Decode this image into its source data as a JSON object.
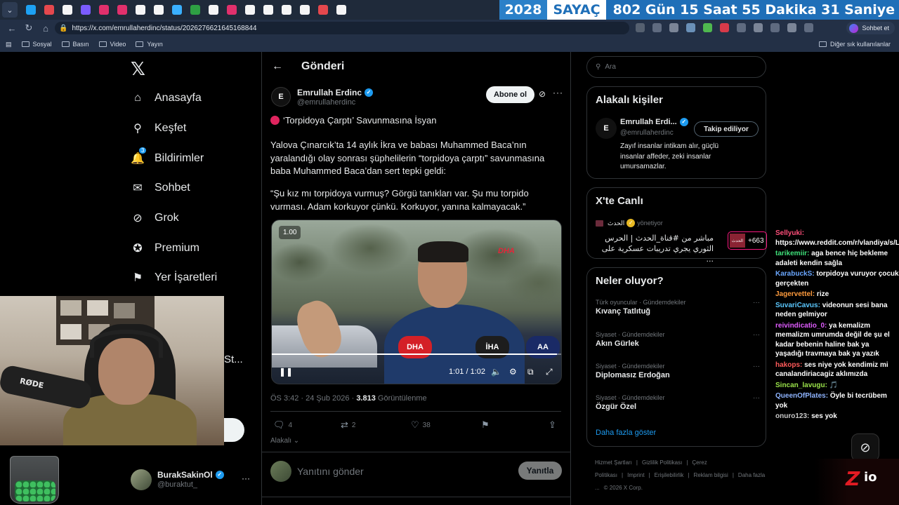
{
  "browser": {
    "url": "https://x.com/emrullaherdinc/status/2026276621645168844",
    "sohbet_label": "Sohbet et",
    "bookmarks": [
      "Sosyal",
      "Basın",
      "Video",
      "Yayın"
    ],
    "other_bookmarks": "Diğer sık kullanılanlar",
    "tab_icon_colors": [
      "#1da1f2",
      "#e5484d",
      "#f5f5f5",
      "#7b5cff",
      "#e1306c",
      "#e1306c",
      "#f5f5f5",
      "#f5f5f5",
      "#3ab0ff",
      "#2ea043",
      "#f5f5f5",
      "#e1306c",
      "#f5f5f5",
      "#f5f5f5",
      "#f5f5f5",
      "#f5f5f5",
      "#e5484d",
      "#f5f5f5"
    ],
    "ext_icon_colors": [
      "#556070",
      "#5f6b80",
      "#7b8597",
      "#6a90b8",
      "#4fb84f",
      "#d73a49",
      "#5f6b80",
      "#7b8597",
      "#5f6b80",
      "#7b8597",
      "#5f6b80"
    ]
  },
  "counter": {
    "year": "2028",
    "label": "SAYAÇ",
    "remaining": "802 Gün  15 Saat  55 Dakika  31 Saniye"
  },
  "nav": {
    "items": [
      {
        "label": "Anasayfa",
        "icon": "home-icon",
        "glyph": "⌂"
      },
      {
        "label": "Keşfet",
        "icon": "search-icon",
        "glyph": "⚲"
      },
      {
        "label": "Bildirimler",
        "icon": "bell-icon",
        "glyph": "🔔",
        "badge": "3"
      },
      {
        "label": "Sohbet",
        "icon": "mail-icon",
        "glyph": "✉"
      },
      {
        "label": "Grok",
        "icon": "grok-icon",
        "glyph": "⊘"
      },
      {
        "label": "Premium",
        "icon": "premium-icon",
        "glyph": "✪"
      },
      {
        "label": "Yer İşaretleri",
        "icon": "bookmark-icon",
        "glyph": "⚑"
      }
    ],
    "partial_label": "St..."
  },
  "me": {
    "name": "BurakSakinOl",
    "handle": "@buraktut_"
  },
  "post": {
    "header_title": "Gönderi",
    "author_name": "Emrullah Erdinc",
    "author_handle": "@emrullaherdinc",
    "avatar_initials": "E",
    "subscribe_label": "Abone ol",
    "headline": "‘Torpidoya Çarptı’ Savunmasına İsyan",
    "para1": "Yalova Çınarcık’ta 14 aylık İkra ve babası Muhammed Baca’nın yaralandığı olay sonrası şüphelilerin “torpidoya çarptı” savunmasına baba Muhammed Baca’dan sert tepki geldi:",
    "para2": "“Şu kız mı torpidoya vurmuş? Görgü tanıkları var. Şu mu torpido vurması. Adam korkuyor çünkü. Korkuyor, yanına kalmayacak.”",
    "video": {
      "speed": "1.00",
      "time": "1:01 / 1:02",
      "progress": 0.98,
      "logo": "DHA",
      "mic1": "DHA",
      "mic2": "İHA"
    },
    "date": "ÖS 3:42 · 24 Şub 2026 · ",
    "views": "3.813",
    "views_label": " Görüntülenme",
    "replies": "4",
    "reposts": "2",
    "likes": "38",
    "relevant": "Alakalı",
    "reply_placeholder": "Yanıtını gönder",
    "reply_button": "Yanıtla"
  },
  "right": {
    "search_placeholder": "Ara",
    "related_title": "Alakalı kişiler",
    "related": {
      "name": "Emrullah Erdi...",
      "handle": "@emrullaherdinc",
      "bio": "Zayıf insanlar intikam alır, güçlü insanlar affeder, zeki insanlar umursamazlar.",
      "follow_label": "Takip ediliyor"
    },
    "live_title": "X'te Canlı",
    "live": {
      "channel": "الحدث",
      "status": "yönetiyor",
      "text": "مباشر من #قناة_الحدث | الحرس الثوري يجري تدريبات عسكرية على ...",
      "count": "+663",
      "thumb": "الحدث"
    },
    "trends_title": "Neler oluyor?",
    "trends": [
      {
        "category": "Türk oyuncular · Gündemdekiler",
        "title": "Kıvanç Tatlıtuğ"
      },
      {
        "category": "Siyaset · Gündemdekiler",
        "title": "Akın Gürlek"
      },
      {
        "category": "Siyaset · Gündemdekiler",
        "title": "Diplomasız Erdoğan"
      },
      {
        "category": "Siyaset · Gündemdekiler",
        "title": "Özgür Özel"
      }
    ],
    "show_more": "Daha fazla göster",
    "footer": [
      "Hizmet Şartları",
      "|",
      "Gizlilik Politikası",
      "|",
      "Çerez Politikası",
      "|",
      "Imprint",
      "|",
      "Erişilebilirlik",
      "|",
      "Reklam bilgisi",
      "|",
      "Daha fazla ...",
      "© 2026 X Corp."
    ]
  },
  "stream": {
    "chat": [
      {
        "user": "Sellyuki:",
        "color": "#ff4f7a",
        "text": "https://www.reddit.com/r/vlandiya/s/L0a7swigVv"
      },
      {
        "user": "tarikemiir:",
        "color": "#3fe07a",
        "text": "aga bence hiç bekleme adaleti kendin sağla"
      },
      {
        "user": "KarabuckS:",
        "color": "#6aa7ff",
        "text": "torpidoya vuruyor çocuk gerçekten"
      },
      {
        "user": "Jagervettel:",
        "color": "#ff9b3d",
        "text": "rize"
      },
      {
        "user": "SuvariCavus:",
        "color": "#5bc8ff",
        "text": "videonun sesi bana neden gelmiyor"
      },
      {
        "user": "reivindicatio_0:",
        "color": "#e05cff",
        "text": "ya kemalizm memalizm umrumda değil de şu el kadar bebenin haline bak ya yaşadığı travmaya bak ya yazık"
      },
      {
        "user": "hakops:",
        "color": "#ff5a5a",
        "text": "ses niye yok kendimiz mi canalandiriacagiz aklımızda"
      },
      {
        "user": "Sincan_lavugu:",
        "color": "#9be34a",
        "text": "🎵"
      },
      {
        "user": "QueenOfPlates:",
        "color": "#8fb4ff",
        "text": "Öyle bi tecrübem yok"
      },
      {
        "user": "onuro123:",
        "color": "#c9c9c9",
        "text": "ses yok"
      }
    ],
    "webcam_mic_brand": "RØDE",
    "logo_left": "Z",
    "logo_right": "io"
  }
}
